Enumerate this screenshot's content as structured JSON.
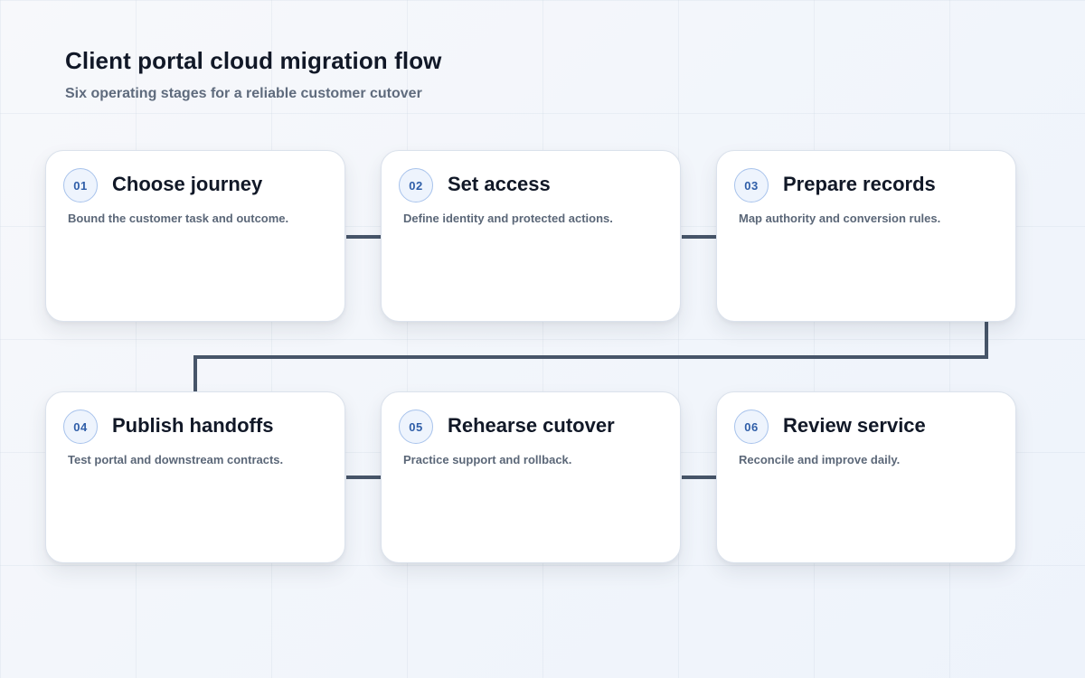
{
  "header": {
    "title": "Client portal cloud migration flow",
    "subtitle": "Six operating stages for a reliable customer cutover"
  },
  "colors": {
    "connector": "#475569",
    "badge_text": "#2f5ea8",
    "badge_border": "#a8c3ec",
    "badge_fill": "#eef4fd"
  },
  "stages": [
    {
      "number": "01",
      "title": "Choose journey",
      "description": "Bound the customer task and outcome."
    },
    {
      "number": "02",
      "title": "Set access",
      "description": "Define identity and protected actions."
    },
    {
      "number": "03",
      "title": "Prepare records",
      "description": "Map authority and conversion rules."
    },
    {
      "number": "04",
      "title": "Publish handoffs",
      "description": "Test portal and downstream contracts."
    },
    {
      "number": "05",
      "title": "Rehearse cutover",
      "description": "Practice support and rollback."
    },
    {
      "number": "06",
      "title": "Review service",
      "description": "Reconcile and improve daily."
    }
  ]
}
